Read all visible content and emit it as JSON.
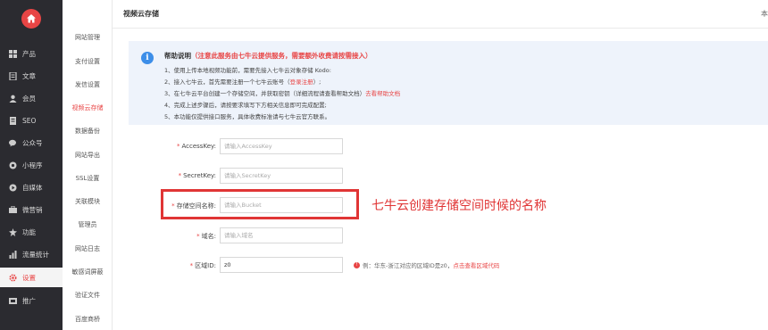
{
  "sidebar": {
    "items": [
      {
        "label": "产品",
        "icon": "grid-icon"
      },
      {
        "label": "文章",
        "icon": "document-icon"
      },
      {
        "label": "会员",
        "icon": "user-icon"
      },
      {
        "label": "SEO",
        "icon": "seo-icon"
      },
      {
        "label": "公众号",
        "icon": "wechat-icon"
      },
      {
        "label": "小程序",
        "icon": "miniprogram-icon"
      },
      {
        "label": "自媒体",
        "icon": "media-icon"
      },
      {
        "label": "微营销",
        "icon": "marketing-icon"
      },
      {
        "label": "功能",
        "icon": "function-icon"
      },
      {
        "label": "流量统计",
        "icon": "stats-icon"
      },
      {
        "label": "设置",
        "icon": "gear-icon"
      },
      {
        "label": "推广",
        "icon": "promote-icon"
      }
    ]
  },
  "submenu": {
    "items": [
      "网站管理",
      "支付设置",
      "发信设置",
      "视频云存储",
      "数据备份",
      "网站导出",
      "SSL设置",
      "关联模块",
      "管理员",
      "网站日志",
      "敏感词屏蔽",
      "验证文件",
      "百度商桥"
    ]
  },
  "header": {
    "title": "视频云存储",
    "right_text": "本"
  },
  "help": {
    "title": "帮助说明",
    "title_note": "（注意此服务由七牛云提供服务，需要额外收费请按需接入）",
    "line1": "1、使用上传本地视频功能前，需要先接入七牛云对象存储 Kodo:",
    "line2_a": "2、接入七牛云，首先需要注册一个七牛云账号（",
    "line2_link": "登录注册",
    "line2_b": "）;",
    "line3_a": "3、在七牛云平台创建一个存储空间，并获取密钥（详细流程请查看帮助文档）",
    "line3_link": "去看帮助文档",
    "line4": "4、完成上述步骤后，请按要求填写下方相关信息即可完成配置;",
    "line5": "5、本功能仅提供接口服务，具体收费标准请与七牛云官方联系。"
  },
  "form": {
    "accesskey_label": "AccessKey:",
    "accesskey_placeholder": "请输入AccessKey",
    "secretkey_label": "SecretKey:",
    "secretkey_placeholder": "请输入SecretKey",
    "bucket_label": "存储空间名称:",
    "bucket_placeholder": "请输入Bucket",
    "domain_label": "域名:",
    "domain_placeholder": "请输入域名",
    "region_label": "区域ID:",
    "region_value": "z0",
    "region_hint": "例：华东-浙江对应的区域ID是z0，",
    "region_hint_link": "点击查看区域代码"
  },
  "annotation": {
    "text": "七牛云创建存储空间时候的名称"
  },
  "colors": {
    "sidebar_bg": "#2b2b30",
    "accent": "#e84545",
    "info_blue": "#3d8ee8",
    "help_bg": "#eef3fb"
  }
}
